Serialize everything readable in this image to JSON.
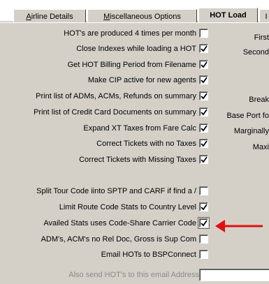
{
  "tabs": [
    {
      "label_pre": "",
      "label_ul": "A",
      "label_post": "irline Details"
    },
    {
      "label_pre": "",
      "label_ul": "M",
      "label_post": "iscellaneous Options"
    },
    {
      "label": "HOT Load"
    },
    {
      "label": "I"
    }
  ],
  "options": [
    {
      "label": "HOT's are produced 4 times per month",
      "checked": false
    },
    {
      "label": "Close Indexes while loading a HOT",
      "checked": true
    },
    {
      "label": "Get HOT Billing Period from Filename",
      "checked": true
    },
    {
      "label": "Make CIP active for new agents",
      "checked": true
    },
    {
      "label": "Print list of ADMs, ACMs, Refunds on summary",
      "checked": true
    },
    {
      "label": "Print list of Credit Card Documents on summary",
      "checked": true
    },
    {
      "label": "Expand XT Taxes from Fare Calc",
      "checked": true
    },
    {
      "label": "Correct Tickets with no Taxes",
      "checked": true
    },
    {
      "label": "Correct Tickets with Missing Taxes",
      "checked": true
    },
    {
      "label": "Split Tour Code iinto SPTP and CARF if find a /",
      "checked": false
    },
    {
      "label": "Limit Route Code Stats to Country Level",
      "checked": true
    },
    {
      "label": "Availed Stats uses Code-Share Carrier Code",
      "checked": true
    },
    {
      "label": "ADM's, ACM's no Rel Doc, Gross is Sup Com",
      "checked": false
    },
    {
      "label": "Email HOTs to BSPConnect",
      "checked": false
    }
  ],
  "email": {
    "label": "Also send HOT's to this email Address",
    "value": ""
  },
  "right_column": [
    "First",
    "Second",
    "Break",
    "Base Port fo",
    "Marginally",
    "Maxi"
  ],
  "colors": {
    "panel": "#d4d0c8",
    "arrow": "#e01010"
  }
}
